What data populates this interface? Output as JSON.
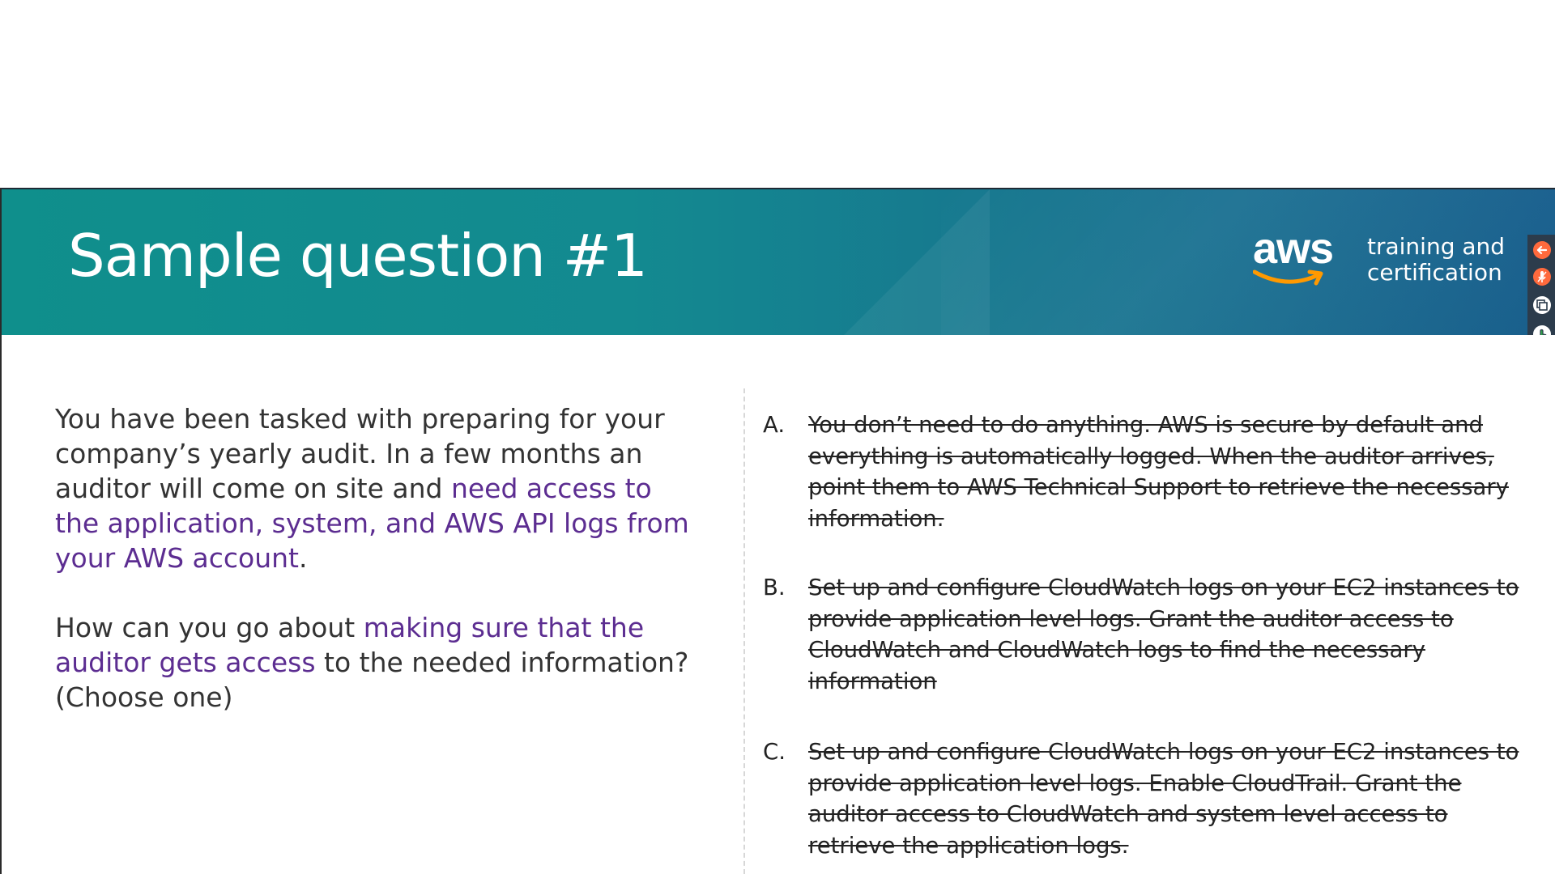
{
  "slide": {
    "title": "Sample question #1",
    "logo": {
      "wordmark": "aws",
      "tagline_line1": "training and",
      "tagline_line2": "certification"
    }
  },
  "toolbar": {
    "buttons": [
      {
        "name": "back-arrow-icon",
        "color": "#ff6a3d"
      },
      {
        "name": "microphone-icon",
        "color": "#ff6a3d"
      },
      {
        "name": "copy-icon",
        "color": "#ffffff"
      },
      {
        "name": "hand-pointer-icon",
        "color": "#ffffff"
      }
    ]
  },
  "question": {
    "p1_part1": "You have been tasked with preparing for your company’s yearly audit. In a few months an auditor will come on site and ",
    "p1_highlight": "need access to the application, system, and AWS API logs from your AWS account",
    "p1_end": ".",
    "p2_part1": "How can you go about ",
    "p2_highlight": "making sure that the auditor gets access",
    "p2_part2": " to the needed information? (Choose one)"
  },
  "answers": [
    {
      "letter": "A.",
      "text": "You don’t need to do anything. AWS is secure by default and everything is automatically logged. When the auditor arrives, point them to AWS Technical Support to retrieve the necessary information.",
      "struck": true
    },
    {
      "letter": "B.",
      "text": "Set up and configure CloudWatch logs on your EC2 instances to provide application level logs. Grant the auditor access to CloudWatch and CloudWatch logs to find the necessary information",
      "struck": true
    },
    {
      "letter": "C.",
      "text": "Set up and configure CloudWatch logs on your EC2 instances to provide application level logs. Enable CloudTrail. Grant the auditor access to CloudWatch and system level access to retrieve the application logs.",
      "struck": true
    }
  ],
  "colors": {
    "highlight": "#5c2d91",
    "banner_start": "#0f8f8c",
    "banner_end": "#1a6393",
    "aws_smile": "#ff9900"
  }
}
